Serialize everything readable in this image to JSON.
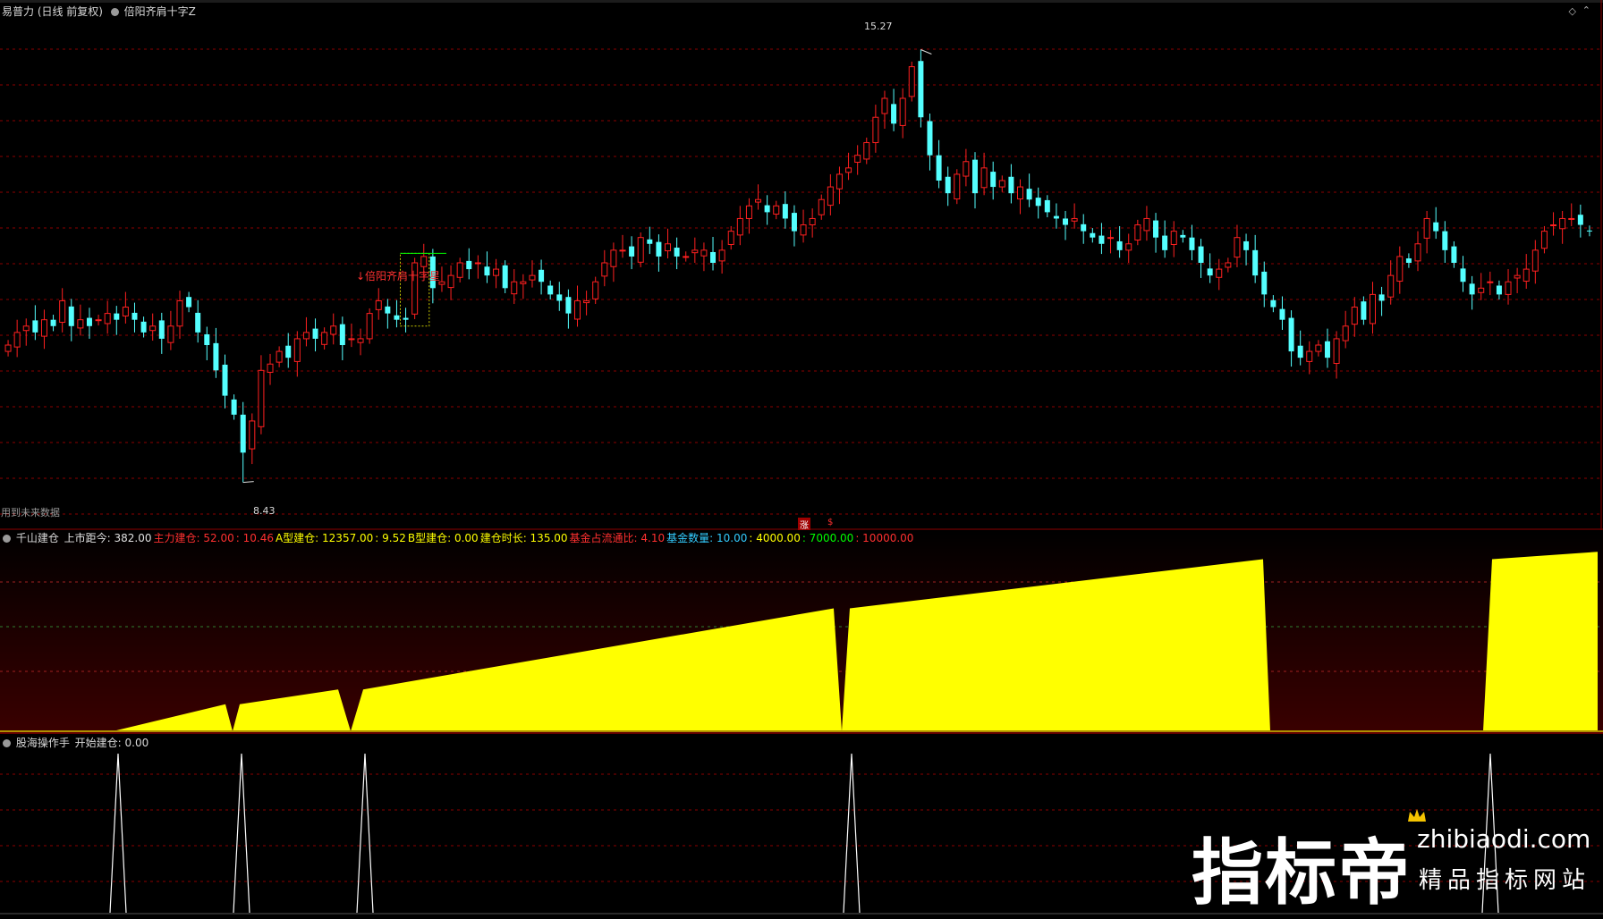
{
  "main": {
    "title": "易普力 (日线 前复权)",
    "indicator": "倍阳齐肩十字Z",
    "future_note": "用到未来数据",
    "annotation": "↓倍阳齐肩十字星",
    "high_label": "15.27",
    "low_label": "8.43",
    "marker1": "涨",
    "marker2": "$"
  },
  "ind1": {
    "name": "千山建仓",
    "items": [
      {
        "text": "上市距今: 382.00",
        "color": "#e0e0e0"
      },
      {
        "text": "主力建仓: 52.00",
        "color": "#ff3030"
      },
      {
        "text": ": 10.46",
        "color": "#ff3030"
      },
      {
        "text": "A型建仓: 12357.00",
        "color": "#ffff00"
      },
      {
        "text": ": 9.52",
        "color": "#ffff00"
      },
      {
        "text": "B型建仓: 0.00",
        "color": "#ffff00"
      },
      {
        "text": "建仓时长: 135.00",
        "color": "#ffff00"
      },
      {
        "text": "基金占流通比: 4.10",
        "color": "#ff3030"
      },
      {
        "text": "基金数量: 10.00",
        "color": "#33ccff"
      },
      {
        "text": ": 4000.00",
        "color": "#ffff00"
      },
      {
        "text": ": 7000.00",
        "color": "#00ff00"
      },
      {
        "text": ": 10000.00",
        "color": "#ff3030"
      }
    ]
  },
  "ind2": {
    "name": "股海操作手",
    "value": "开始建仓: 0.00"
  },
  "watermark": {
    "cn": "指标帝",
    "url": "zhibiaodi.com",
    "slogan": "精品指标网站"
  },
  "colors": {
    "up": "#ff2020",
    "down": "#54ffff",
    "fill": "#ffff00",
    "grid": "#8b0000",
    "spike": "#ffffff"
  },
  "chart_data": [
    {
      "type": "candlestick",
      "title": "易普力 (日线 前复权)",
      "ylim": [
        8.0,
        15.8
      ],
      "high": 15.27,
      "low": 8.43,
      "closes": [
        10.6,
        10.8,
        10.9,
        10.8,
        11.0,
        10.9,
        11.3,
        10.9,
        11.0,
        10.9,
        11.0,
        11.1,
        11.0,
        11.2,
        11.0,
        10.8,
        10.9,
        10.7,
        10.9,
        11.3,
        11.2,
        10.8,
        10.6,
        10.2,
        9.8,
        9.5,
        8.9,
        9.4,
        10.2,
        10.3,
        10.5,
        10.4,
        10.7,
        10.8,
        10.7,
        10.8,
        10.9,
        10.6,
        10.7,
        10.7,
        11.1,
        11.3,
        11.1,
        11.0,
        11.0,
        11.9,
        12.0,
        11.5,
        11.6,
        11.7,
        11.9,
        11.8,
        11.9,
        11.7,
        11.8,
        11.5,
        11.6,
        11.6,
        11.7,
        11.6,
        11.4,
        11.3,
        11.1,
        11.3,
        11.3,
        11.6,
        11.9,
        12.1,
        12.1,
        12.0,
        12.3,
        12.2,
        12.0,
        12.2,
        12.0,
        12.0,
        12.1,
        12.1,
        11.9,
        12.1,
        12.4,
        12.6,
        12.8,
        12.9,
        12.7,
        12.8,
        12.6,
        12.4,
        12.5,
        12.6,
        12.9,
        13.1,
        13.3,
        13.4,
        13.6,
        13.8,
        14.2,
        14.5,
        14.1,
        14.5,
        15.0,
        14.2,
        13.6,
        13.2,
        13.0,
        13.3,
        13.5,
        13.0,
        13.4,
        13.1,
        13.2,
        13.0,
        13.1,
        12.9,
        12.8,
        12.7,
        12.6,
        12.5,
        12.6,
        12.4,
        12.3,
        12.2,
        12.3,
        12.1,
        12.2,
        12.5,
        12.6,
        12.3,
        12.1,
        12.4,
        12.3,
        12.1,
        11.9,
        11.7,
        11.8,
        11.9,
        12.3,
        12.1,
        11.7,
        11.4,
        11.2,
        11.0,
        10.5,
        10.4,
        10.5,
        10.6,
        10.4,
        10.7,
        10.9,
        11.2,
        11.0,
        11.4,
        11.3,
        11.7,
        12.0,
        11.9,
        12.2,
        12.6,
        12.4,
        12.1,
        11.9,
        11.6,
        11.4,
        11.5,
        11.6,
        11.4,
        11.6,
        11.7,
        11.8,
        12.1,
        12.4,
        12.5,
        12.6,
        12.6,
        12.5,
        12.4
      ]
    },
    {
      "type": "area",
      "title": "千山建仓",
      "values": [
        0,
        0,
        0,
        0,
        0,
        0,
        0,
        0,
        0,
        0,
        0,
        0,
        0,
        0,
        0.02,
        0.03,
        0.05,
        0.07,
        0.09,
        0.11,
        0.13,
        0.15,
        0.17,
        0.19,
        0.21,
        0.23,
        0.25,
        0.27,
        0.29,
        0.31,
        0.33,
        0.35,
        0.37,
        0.39,
        0.41,
        0.43,
        0.45,
        0.47,
        0.5,
        0.52,
        0.54,
        0.56,
        0.58,
        0.6,
        0.62,
        0.64,
        0.66,
        0.68,
        0.7,
        0.72,
        0.74,
        0.76,
        0.78,
        0.8,
        0.82,
        0.84,
        0.86,
        0.88,
        0.9,
        0.92,
        0.94,
        0.96,
        0.98,
        1.0
      ]
    },
    {
      "type": "line",
      "title": "股海操作手",
      "values": [
        0,
        1,
        0,
        1,
        0,
        1,
        0,
        1,
        0,
        1,
        0
      ]
    }
  ]
}
